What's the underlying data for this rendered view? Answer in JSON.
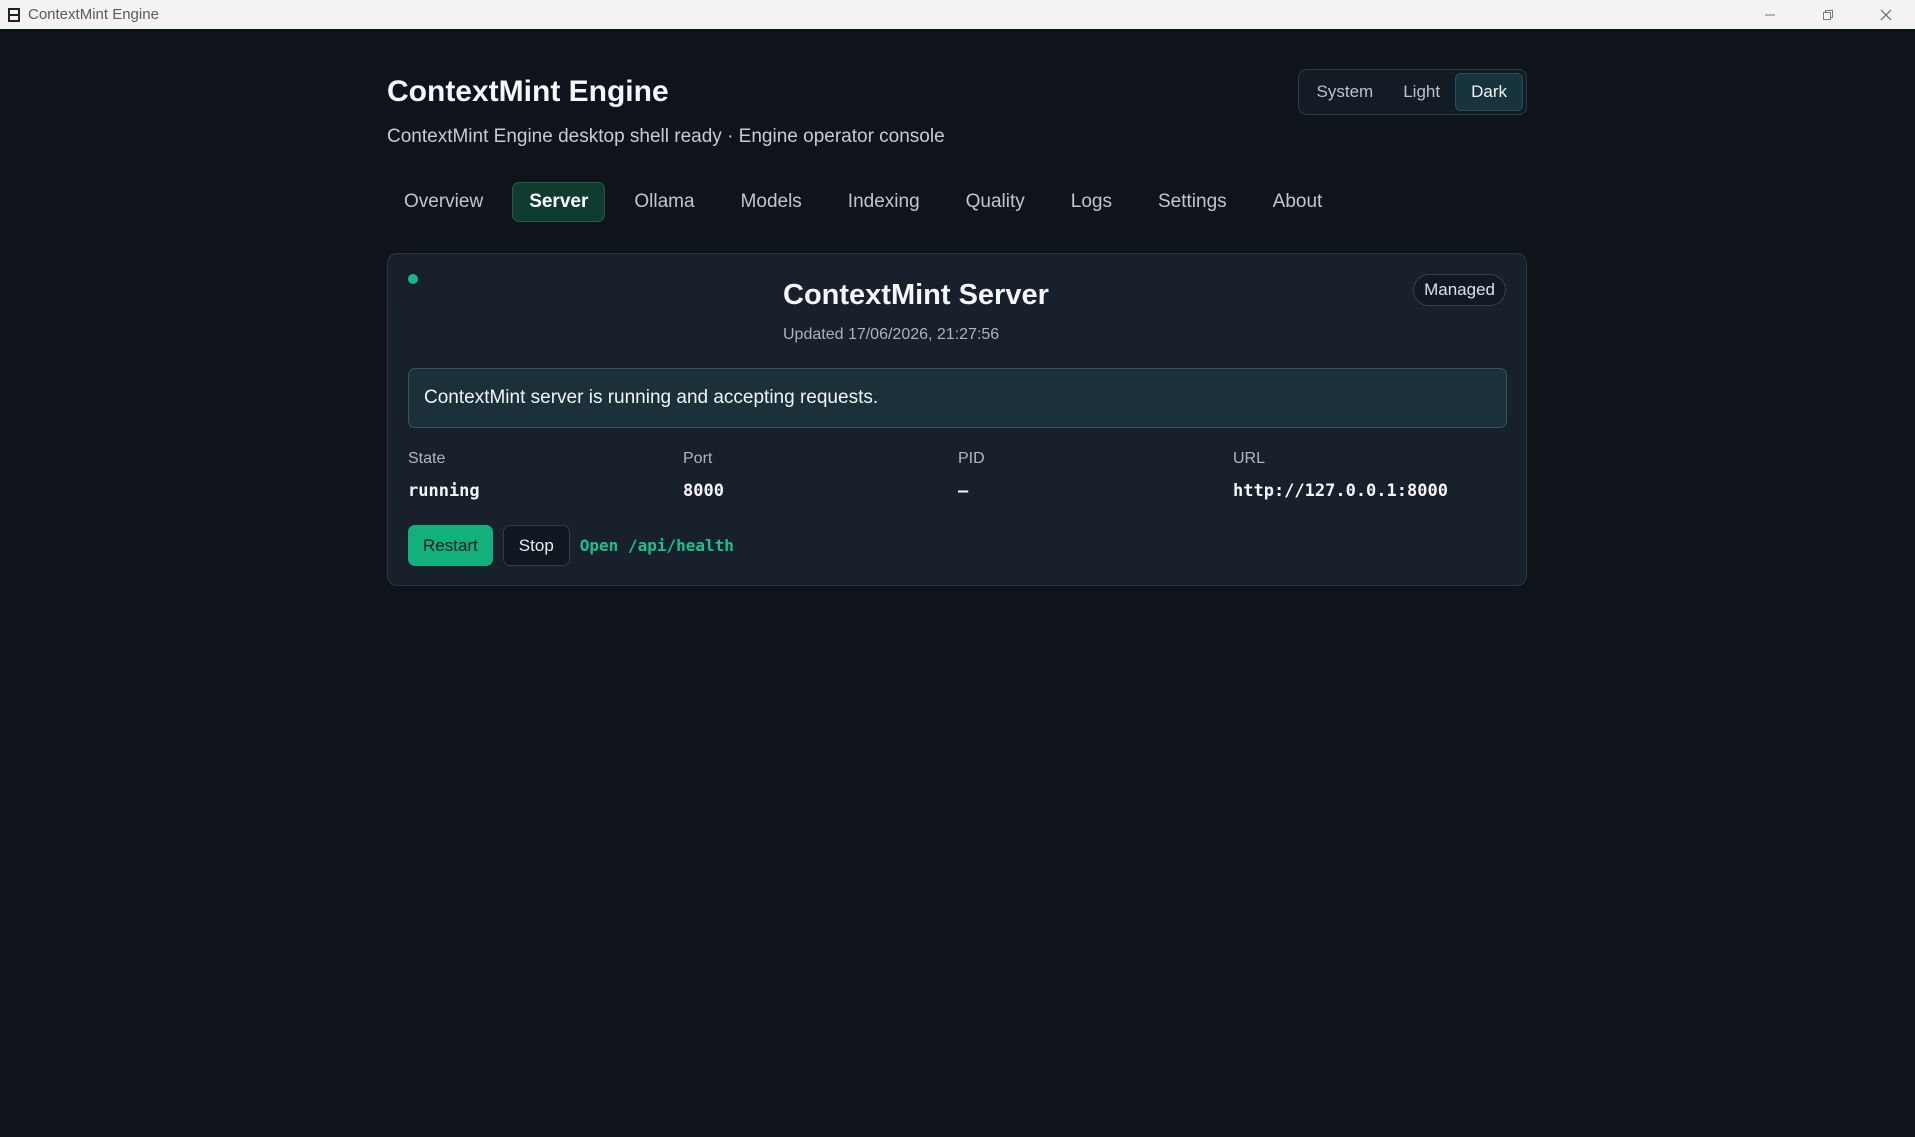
{
  "window": {
    "title": "ContextMint Engine",
    "icon": "app-icon",
    "controls": [
      "minimize-icon",
      "restore-icon",
      "close-icon"
    ]
  },
  "header": {
    "title": "ContextMint Engine",
    "subtitle": "ContextMint Engine desktop shell ready · Engine operator console"
  },
  "theme": {
    "options": [
      "System",
      "Light",
      "Dark"
    ],
    "selected": "Dark"
  },
  "tabs": [
    {
      "label": "Overview"
    },
    {
      "label": "Server",
      "active": true
    },
    {
      "label": "Ollama"
    },
    {
      "label": "Models"
    },
    {
      "label": "Indexing"
    },
    {
      "label": "Quality"
    },
    {
      "label": "Logs"
    },
    {
      "label": "Settings"
    },
    {
      "label": "About"
    }
  ],
  "server_card": {
    "title": "ContextMint Server",
    "updated": "Updated 17/06/2026, 21:27:56",
    "badge": "Managed",
    "status_color": "#18b887",
    "message": "ContextMint server is running and accepting requests.",
    "stats": [
      {
        "label": "State",
        "value": "running"
      },
      {
        "label": "Port",
        "value": "8000"
      },
      {
        "label": "PID",
        "value": "—"
      },
      {
        "label": "URL",
        "value": "http://127.0.0.1:8000"
      }
    ],
    "actions": {
      "restart": "Restart",
      "stop": "Stop",
      "health_link": "Open /api/health"
    }
  },
  "colors": {
    "background": "#0e141a",
    "accent": "#12b07c",
    "card": "#17202b"
  }
}
